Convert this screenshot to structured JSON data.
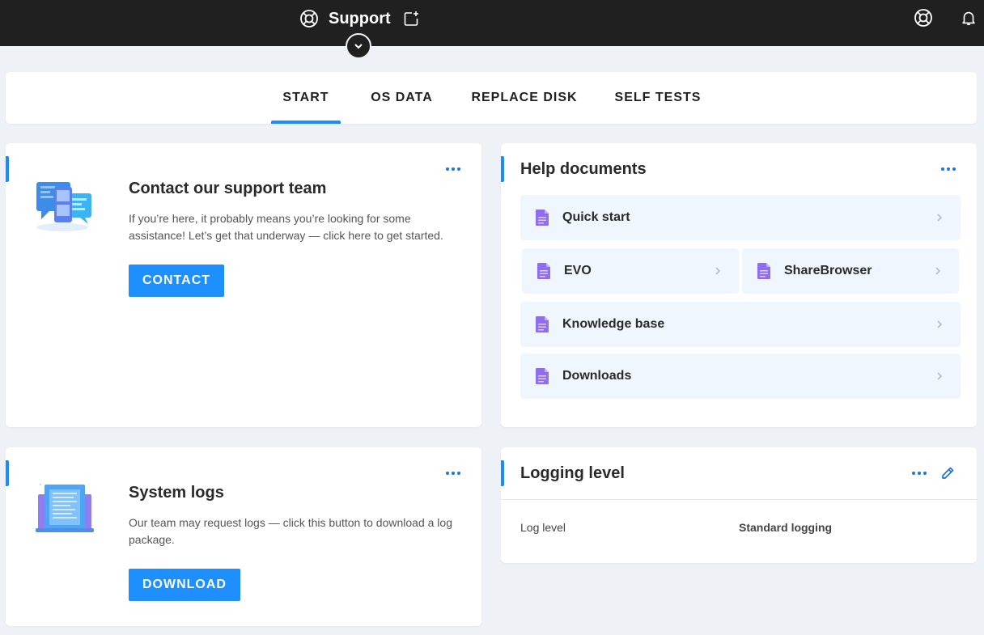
{
  "header": {
    "title": "Support",
    "app_icon": "lifebuoy-icon",
    "new_window_icon": "open-new-window-icon",
    "right_icons": [
      "lifebuoy-icon",
      "bell-icon"
    ],
    "collapse_icon": "chevron-down-icon"
  },
  "tabs": [
    {
      "label": "START",
      "active": true
    },
    {
      "label": "OS DATA",
      "active": false
    },
    {
      "label": "REPLACE DISK",
      "active": false
    },
    {
      "label": "SELF TESTS",
      "active": false
    }
  ],
  "contact_card": {
    "title": "Contact our support team",
    "description": "If you’re here, it probably means you’re looking for some assistance! Let’s get that underway — click here to get started.",
    "button_label": "CONTACT",
    "illustration": "chat-bubbles-illustration"
  },
  "help_card": {
    "title": "Help documents",
    "items": [
      {
        "label": "Quick start",
        "icon": "document-icon"
      },
      {
        "label": "EVO",
        "icon": "document-icon"
      },
      {
        "label": "ShareBrowser",
        "icon": "document-icon"
      },
      {
        "label": "Knowledge base",
        "icon": "document-icon"
      },
      {
        "label": "Downloads",
        "icon": "document-icon"
      }
    ]
  },
  "logs_card": {
    "title": "System logs",
    "description": "Our team may request logs — click this button to download a log package.",
    "button_label": "DOWNLOAD",
    "illustration": "laptop-log-illustration"
  },
  "logging_card": {
    "title": "Logging level",
    "rows": [
      {
        "key": "Log level",
        "value": "Standard logging"
      }
    ]
  },
  "colors": {
    "accent": "#1a8cff",
    "topbar": "#202020",
    "background": "#eef1f5"
  }
}
